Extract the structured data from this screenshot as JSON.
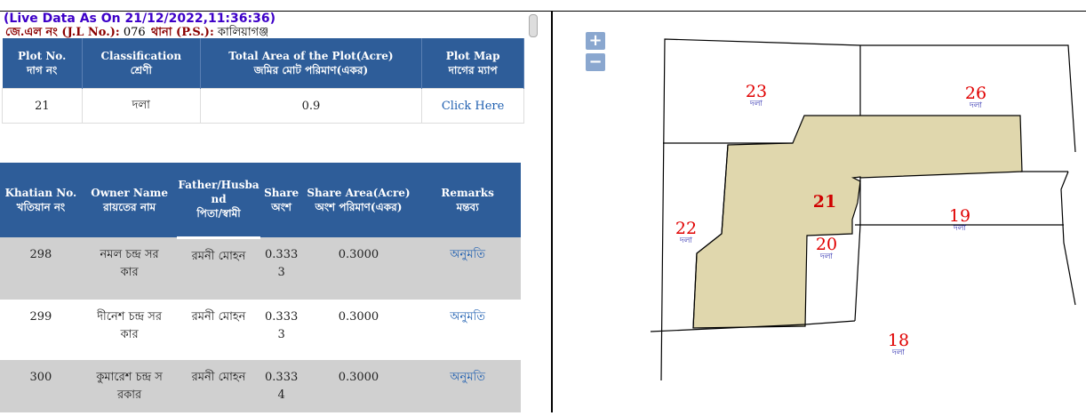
{
  "header": {
    "live_data": "(Live Data As On 21/12/2022,11:36:36)",
    "jl_label": "জে.এল নং (J.L No.):",
    "jl_value": "076",
    "ps_label": "থানা (P.S.):",
    "ps_value": "কালিয়াগঞ্জ"
  },
  "plot_table": {
    "headers": [
      [
        "Plot No.",
        "দাগ নং"
      ],
      [
        "Classification",
        "শ্রেণী"
      ],
      [
        "Total Area of the Plot(Acre)",
        "জমির মোট পরিমাণ(একর)"
      ],
      [
        "Plot Map",
        "দাগের ম্যাপ"
      ]
    ],
    "row": {
      "plot_no": "21",
      "classification": "দলা",
      "area": "0.9",
      "map_link": "Click Here"
    }
  },
  "owner_table": {
    "headers": [
      [
        "Khatian No.",
        "খতিয়ান নং"
      ],
      [
        "Owner Name",
        "রায়তের নাম"
      ],
      [
        "Father/Husba",
        "nd",
        "পিতা/স্বামী"
      ],
      [
        "Share",
        "অংশ"
      ],
      [
        "Share Area(Acre)",
        "অংশ পরিমাণ(একর)"
      ],
      [
        "Remarks",
        "মন্তব্য"
      ]
    ],
    "rows": [
      {
        "khatian": "298",
        "owner": [
          "নমল চন্দ্র সর",
          "কার"
        ],
        "father": "রমনী মোহন",
        "share": [
          "0.333",
          "3"
        ],
        "share_area": "0.3000",
        "remarks": "অনুমতি"
      },
      {
        "khatian": "299",
        "owner": [
          "দীনেশ চন্দ্র সর",
          "কার"
        ],
        "father": "রমনী মোহন",
        "share": [
          "0.333",
          "3"
        ],
        "share_area": "0.3000",
        "remarks": "অনুমতি"
      },
      {
        "khatian": "300",
        "owner": [
          "কুমারেশ চন্দ্র স",
          "রকার"
        ],
        "father": "রমনী মোহন",
        "share": [
          "0.333",
          "4"
        ],
        "share_area": "0.3000",
        "remarks": "অনুমতি"
      }
    ]
  },
  "map": {
    "zoom_in": "+",
    "zoom_out": "−",
    "selected_fill": "#e0d7ad",
    "plots": [
      {
        "number": "23",
        "class": "দলা"
      },
      {
        "number": "26",
        "class": "দলা"
      },
      {
        "number": "21"
      },
      {
        "number": "22",
        "class": "দলা"
      },
      {
        "number": "19",
        "class": "দলা"
      },
      {
        "number": "20",
        "class": "দলা"
      },
      {
        "number": "18",
        "class": "দলা"
      }
    ]
  }
}
